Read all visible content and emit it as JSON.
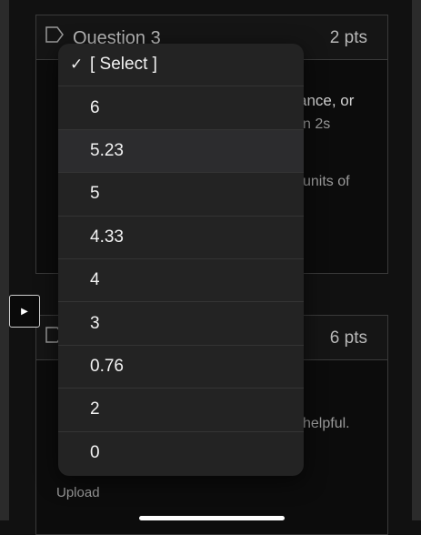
{
  "question3": {
    "title": "Question 3",
    "points": "2 pts"
  },
  "question4": {
    "points": "6 pts"
  },
  "background_fragments": {
    "q3_line1": "ance, or",
    "q3_line2": "n 2s",
    "q3_line3": "units of",
    "q4_line1": "helpful.",
    "upload": "Upload"
  },
  "dropdown": {
    "selected_check": "✓",
    "options": [
      "[ Select ]",
      "6",
      "5.23",
      "5",
      "4.33",
      "4",
      "3",
      "0.76",
      "2",
      "0"
    ]
  },
  "icons": {
    "side_button": "play-right-icon",
    "bookmark": "bookmark-icon"
  }
}
